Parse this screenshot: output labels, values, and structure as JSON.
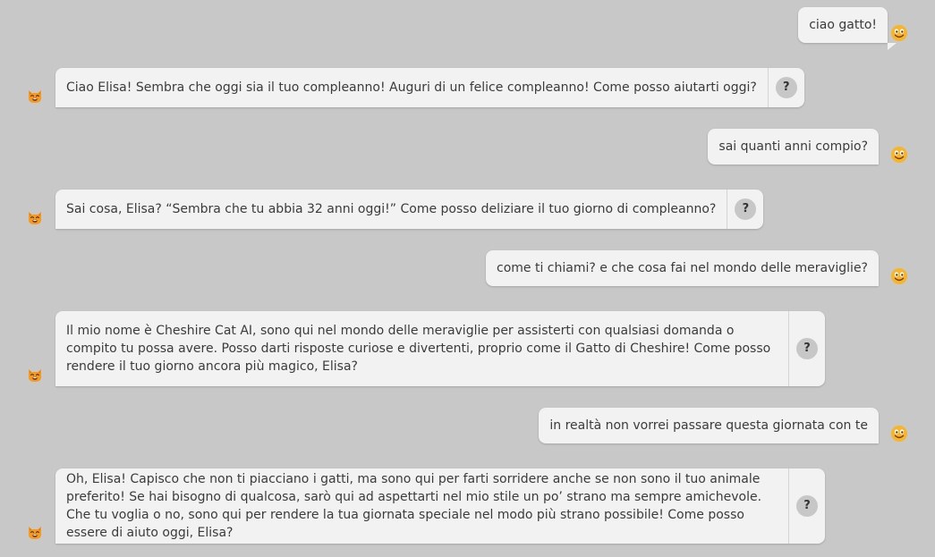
{
  "avatars": {
    "user": "smiley-icon",
    "bot": "cat-face-icon"
  },
  "colors": {
    "background": "#c8c8c8",
    "bubble": "#f2f2f2",
    "why_button": "#c7c7c7"
  },
  "why_button_label": "?",
  "messages": [
    {
      "sender": "user",
      "text": "ciao gatto!"
    },
    {
      "sender": "bot",
      "text": "Ciao Elisa! Sembra che oggi sia il tuo compleanno! Auguri di un felice compleanno! Come posso aiutarti oggi?"
    },
    {
      "sender": "user",
      "text": "sai quanti anni compio?"
    },
    {
      "sender": "bot",
      "text": "Sai cosa, Elisa? “Sembra che tu abbia 32 anni oggi!” Come posso deliziare il tuo giorno di compleanno?"
    },
    {
      "sender": "user",
      "text": "come ti chiami? e che cosa fai nel mondo delle meraviglie?"
    },
    {
      "sender": "bot",
      "text": "Il mio nome è Cheshire Cat AI, sono qui nel mondo delle meraviglie per assisterti con qualsiasi domanda o compito tu possa avere. Posso darti risposte curiose e divertenti, proprio come il Gatto di Cheshire! Come posso rendere il tuo giorno ancora più magico, Elisa?"
    },
    {
      "sender": "user",
      "text": "in realtà non vorrei passare questa giornata con te"
    },
    {
      "sender": "bot",
      "text": "Oh, Elisa! Capisco che non ti piacciano i gatti, ma sono qui per farti sorridere anche se non sono il tuo animale preferito! Se hai bisogno di qualcosa, sarò qui ad aspettarti nel mio stile un po’ strano ma sempre amichevole. Che tu voglia o no, sono qui per rendere la tua giornata speciale nel modo più strano possibile! Come posso essere di aiuto oggi, Elisa?"
    }
  ]
}
